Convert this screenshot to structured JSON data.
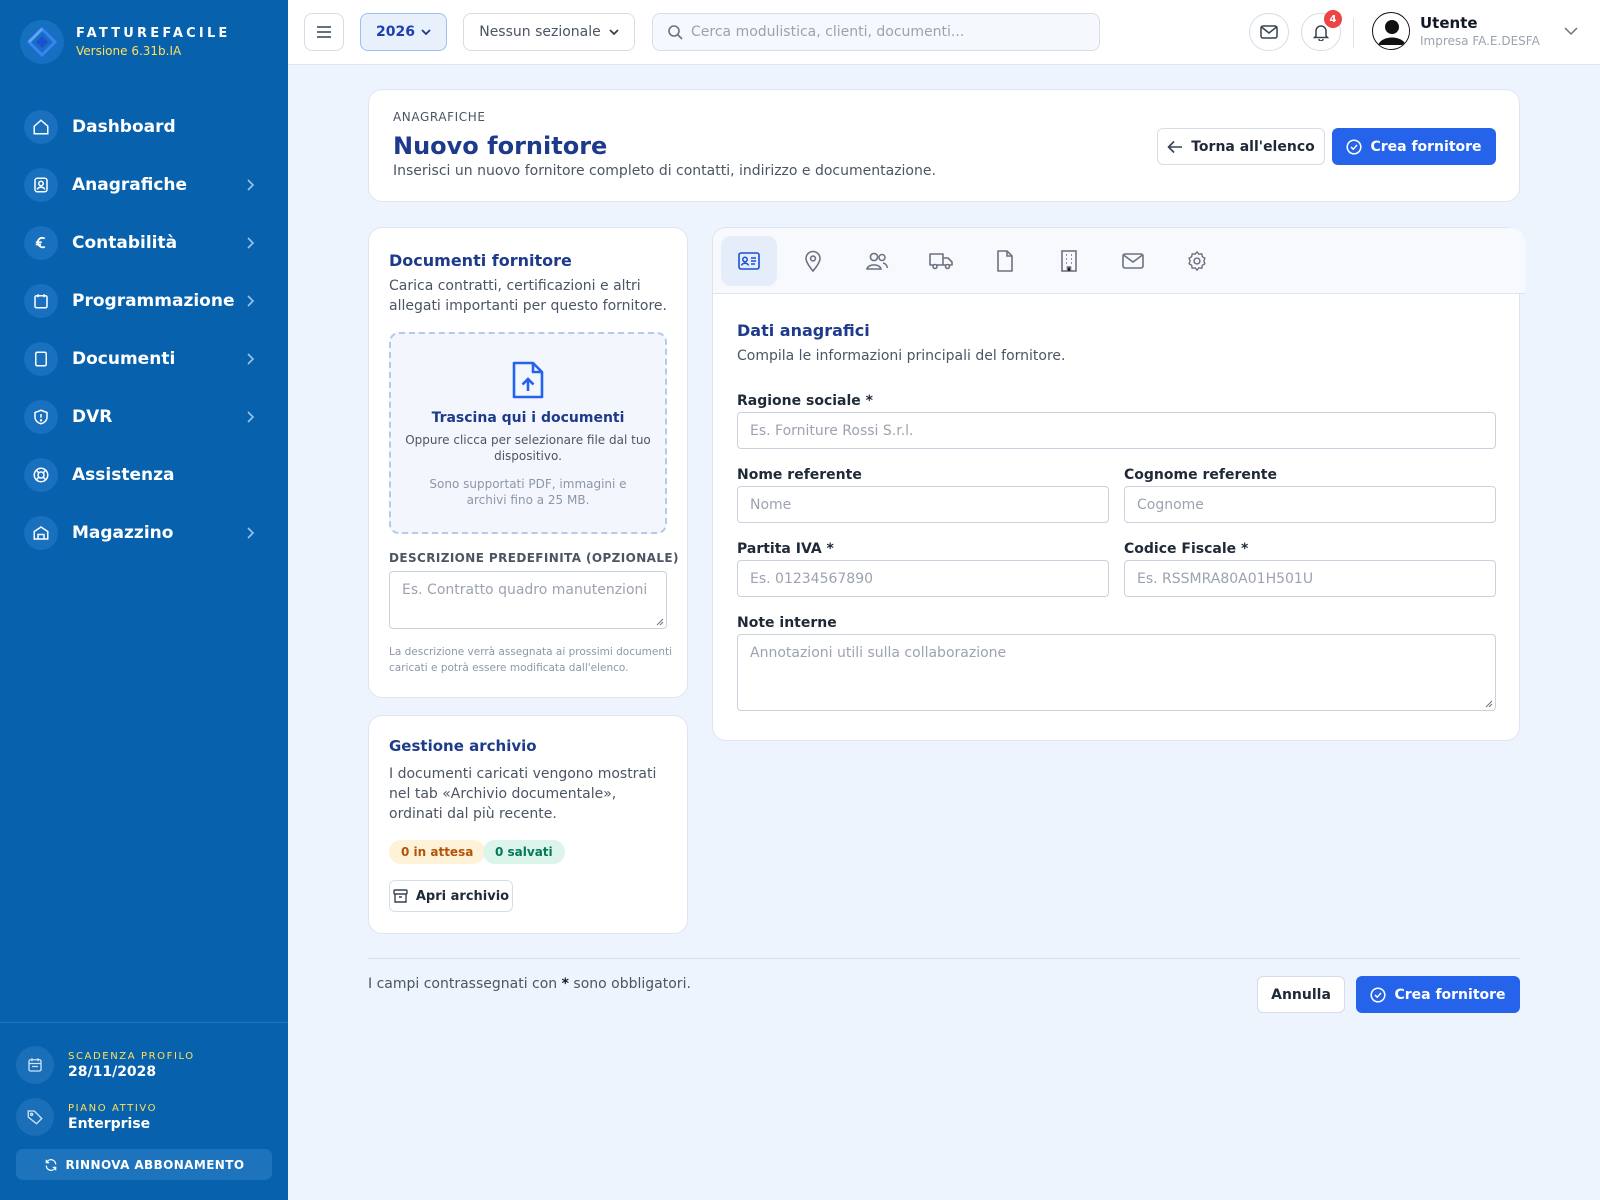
{
  "brand": {
    "name": "FATTUREFACILE",
    "version": "Versione 6.31b.IA"
  },
  "nav": [
    {
      "label": "Dashboard",
      "icon": "home-icon",
      "chevron": false
    },
    {
      "label": "Anagrafiche",
      "icon": "contact-card-icon",
      "chevron": true
    },
    {
      "label": "Contabilità",
      "icon": "euro-icon",
      "chevron": true
    },
    {
      "label": "Programmazione",
      "icon": "calendar-icon",
      "chevron": true
    },
    {
      "label": "Documenti",
      "icon": "document-icon",
      "chevron": true
    },
    {
      "label": "DVR",
      "icon": "shield-icon",
      "chevron": true
    },
    {
      "label": "Assistenza",
      "icon": "lifebuoy-icon",
      "chevron": false
    },
    {
      "label": "Magazzino",
      "icon": "warehouse-icon",
      "chevron": true
    }
  ],
  "sidebar_bottom": {
    "expiry_caption": "SCADENZA PROFILO",
    "expiry_value": "28/11/2028",
    "plan_caption": "PIANO ATTIVO",
    "plan_value": "Enterprise",
    "renew_label": "RINNOVA ABBONAMENTO"
  },
  "topbar": {
    "year": "2026",
    "sezionale": "Nessun sezionale",
    "search_placeholder": "Cerca modulistica, clienti, documenti...",
    "notifications": "4",
    "user_name": "Utente",
    "user_company": "Impresa FA.E.DESFA"
  },
  "header": {
    "breadcrumb": "ANAGRAFICHE",
    "title": "Nuovo fornitore",
    "subtitle": "Inserisci un nuovo fornitore completo di contatti, indirizzo e documentazione.",
    "back_label": "Torna all'elenco",
    "create_label": "Crea fornitore"
  },
  "docs": {
    "title": "Documenti fornitore",
    "text": "Carica contratti, certificazioni e altri allegati importanti per questo fornitore.",
    "drop_title": "Trascina qui i documenti",
    "drop_sub": "Oppure clicca per selezionare file dal tuo dispositivo.",
    "drop_note": "Sono supportati PDF, immagini e archivi fino a 25 MB.",
    "desc_label": "DESCRIZIONE PREDEFINITA (OPZIONALE)",
    "desc_placeholder": "Es. Contratto quadro manutenzioni",
    "hint": "La descrizione verrà assegnata ai prossimi documenti caricati e potrà essere modificata dall'elenco."
  },
  "archive": {
    "title": "Gestione archivio",
    "text": "I documenti caricati vengono mostrati nel tab «Archivio documentale», ordinati dal più recente.",
    "pending": "0 in attesa",
    "saved": "0 salvati",
    "open_label": "Apri archivio"
  },
  "tabs": [
    "id-card-icon",
    "map-pin-icon",
    "users-icon",
    "truck-icon",
    "file-icon",
    "building-icon",
    "mail-icon",
    "settings-icon"
  ],
  "form": {
    "title": "Dati anagrafici",
    "subtitle": "Compila le informazioni principali del fornitore.",
    "ragione_label": "Ragione sociale *",
    "ragione_ph": "Es. Forniture Rossi S.r.l.",
    "nome_label": "Nome referente",
    "nome_ph": "Nome",
    "cognome_label": "Cognome referente",
    "cognome_ph": "Cognome",
    "piva_label": "Partita IVA *",
    "piva_ph": "Es. 01234567890",
    "cf_label": "Codice Fiscale *",
    "cf_ph": "Es. RSSMRA80A01H501U",
    "note_label": "Note interne",
    "note_ph": "Annotazioni utili sulla collaborazione"
  },
  "footer": {
    "note_pre": "I campi contrassegnati con",
    "note_star": "*",
    "note_post": "sono obbligatori.",
    "cancel_label": "Annulla",
    "create_label": "Crea fornitore"
  },
  "colors": {
    "sidebar": "#0761ad",
    "primary": "#2563eb",
    "title": "#1e3a8a",
    "accent": "#ffe15a",
    "background": "#eef4fd"
  }
}
